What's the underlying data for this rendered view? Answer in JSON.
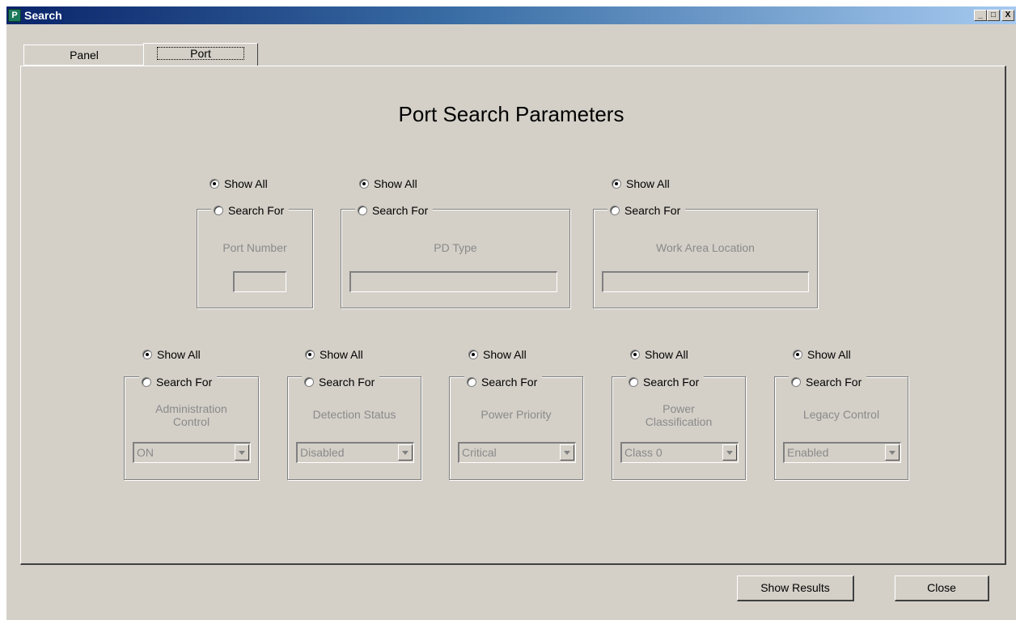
{
  "window": {
    "title": "Search",
    "app_icon_letter": "P",
    "minimize": "_",
    "maximize": "□",
    "close": "X"
  },
  "tabs": [
    {
      "label": "Panel"
    },
    {
      "label": "Port"
    }
  ],
  "heading": "Port Search Parameters",
  "radio": {
    "show_all": "Show All",
    "search_for": "Search For"
  },
  "text_groups": [
    {
      "label": "Port Number",
      "value": ""
    },
    {
      "label": "PD Type",
      "value": ""
    },
    {
      "label": "Work Area Location",
      "value": ""
    }
  ],
  "select_groups": [
    {
      "label_line1": "Administration",
      "label_line2": "Control",
      "selected": "ON"
    },
    {
      "label_line1": "Detection Status",
      "label_line2": "",
      "selected": "Disabled"
    },
    {
      "label_line1": "Power Priority",
      "label_line2": "",
      "selected": "Critical"
    },
    {
      "label_line1": "Power",
      "label_line2": "Classification",
      "selected": "Class 0"
    },
    {
      "label_line1": "Legacy Control",
      "label_line2": "",
      "selected": "Enabled"
    }
  ],
  "buttons": {
    "show_results": "Show Results",
    "close": "Close"
  }
}
